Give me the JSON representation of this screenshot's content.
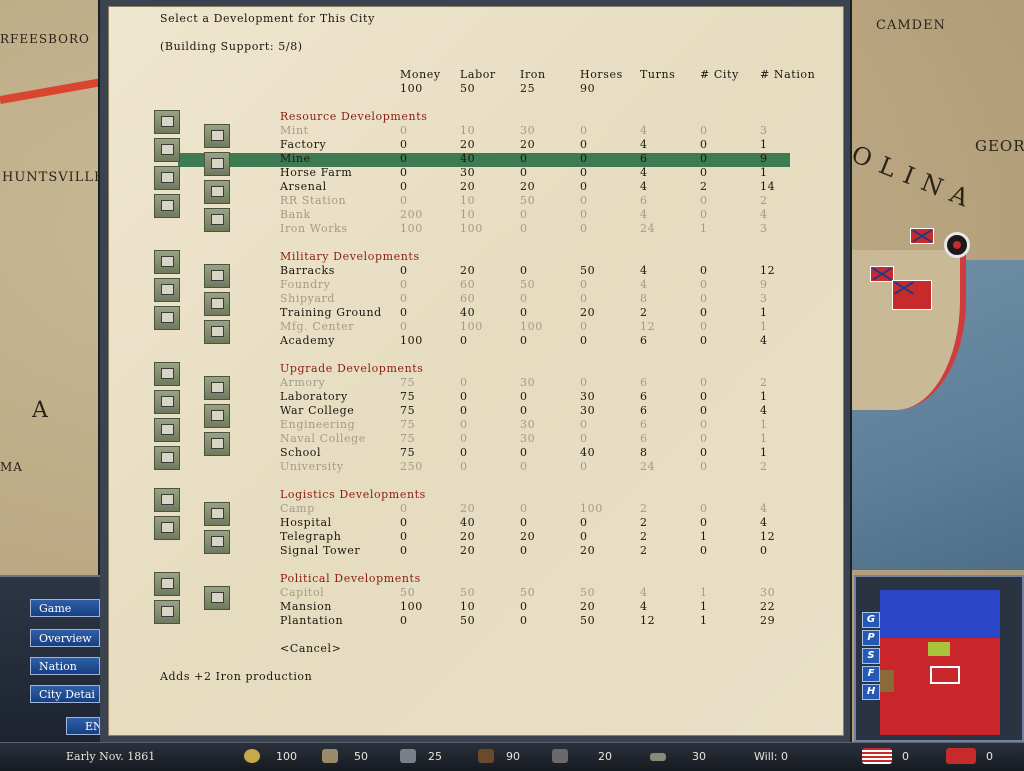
{
  "map": {
    "labels": [
      "CAMDEN",
      "RFEESBORO",
      "HUNTSVILLE",
      "GEORG",
      "OLINA",
      "MA",
      "A"
    ]
  },
  "dialog": {
    "title": "Select a Development for This City",
    "support": "(Building Support: 5/8)",
    "columns": [
      "Money",
      "Labor",
      "Iron",
      "Horses",
      "Turns",
      "# City",
      "# Nation"
    ],
    "available": [
      "100",
      "50",
      "25",
      "90"
    ],
    "cancel": "<Cancel>",
    "description": "Adds +2 Iron production",
    "sections": [
      {
        "name": "Resource Developments",
        "rows": [
          {
            "name": "Mint",
            "vals": [
              "0",
              "10",
              "30",
              "0",
              "4",
              "0",
              "3"
            ],
            "enabled": false
          },
          {
            "name": "Factory",
            "vals": [
              "0",
              "20",
              "20",
              "0",
              "4",
              "0",
              "1"
            ],
            "enabled": true
          },
          {
            "name": "Mine",
            "vals": [
              "0",
              "40",
              "0",
              "0",
              "6",
              "0",
              "9"
            ],
            "enabled": true,
            "selected": true
          },
          {
            "name": "Horse Farm",
            "vals": [
              "0",
              "30",
              "0",
              "0",
              "4",
              "0",
              "1"
            ],
            "enabled": true
          },
          {
            "name": "Arsenal",
            "vals": [
              "0",
              "20",
              "20",
              "0",
              "4",
              "2",
              "14"
            ],
            "enabled": true
          },
          {
            "name": "RR Station",
            "vals": [
              "0",
              "10",
              "50",
              "0",
              "6",
              "0",
              "2"
            ],
            "enabled": false
          },
          {
            "name": "Bank",
            "vals": [
              "200",
              "10",
              "0",
              "0",
              "4",
              "0",
              "4"
            ],
            "enabled": false
          },
          {
            "name": "Iron Works",
            "vals": [
              "100",
              "100",
              "0",
              "0",
              "24",
              "1",
              "3"
            ],
            "enabled": false
          }
        ]
      },
      {
        "name": "Military Developments",
        "rows": [
          {
            "name": "Barracks",
            "vals": [
              "0",
              "20",
              "0",
              "50",
              "4",
              "0",
              "12"
            ],
            "enabled": true
          },
          {
            "name": "Foundry",
            "vals": [
              "0",
              "60",
              "50",
              "0",
              "4",
              "0",
              "9"
            ],
            "enabled": false
          },
          {
            "name": "Shipyard",
            "vals": [
              "0",
              "60",
              "0",
              "0",
              "8",
              "0",
              "3"
            ],
            "enabled": false
          },
          {
            "name": "Training Ground",
            "vals": [
              "0",
              "40",
              "0",
              "20",
              "2",
              "0",
              "1"
            ],
            "enabled": true
          },
          {
            "name": "Mfg. Center",
            "vals": [
              "0",
              "100",
              "100",
              "0",
              "12",
              "0",
              "1"
            ],
            "enabled": false
          },
          {
            "name": "Academy",
            "vals": [
              "100",
              "0",
              "0",
              "0",
              "6",
              "0",
              "4"
            ],
            "enabled": true
          }
        ]
      },
      {
        "name": "Upgrade Developments",
        "rows": [
          {
            "name": "Armory",
            "vals": [
              "75",
              "0",
              "30",
              "0",
              "6",
              "0",
              "2"
            ],
            "enabled": false
          },
          {
            "name": "Laboratory",
            "vals": [
              "75",
              "0",
              "0",
              "30",
              "6",
              "0",
              "1"
            ],
            "enabled": true
          },
          {
            "name": "War College",
            "vals": [
              "75",
              "0",
              "0",
              "30",
              "6",
              "0",
              "4"
            ],
            "enabled": true
          },
          {
            "name": "Engineering",
            "vals": [
              "75",
              "0",
              "30",
              "0",
              "6",
              "0",
              "1"
            ],
            "enabled": false
          },
          {
            "name": "Naval College",
            "vals": [
              "75",
              "0",
              "30",
              "0",
              "6",
              "0",
              "1"
            ],
            "enabled": false
          },
          {
            "name": "School",
            "vals": [
              "75",
              "0",
              "0",
              "40",
              "8",
              "0",
              "1"
            ],
            "enabled": true
          },
          {
            "name": "University",
            "vals": [
              "250",
              "0",
              "0",
              "0",
              "24",
              "0",
              "2"
            ],
            "enabled": false
          }
        ]
      },
      {
        "name": "Logistics Developments",
        "rows": [
          {
            "name": "Camp",
            "vals": [
              "0",
              "20",
              "0",
              "100",
              "2",
              "0",
              "4"
            ],
            "enabled": false
          },
          {
            "name": "Hospital",
            "vals": [
              "0",
              "40",
              "0",
              "0",
              "2",
              "0",
              "4"
            ],
            "enabled": true
          },
          {
            "name": "Telegraph",
            "vals": [
              "0",
              "20",
              "20",
              "0",
              "2",
              "1",
              "12"
            ],
            "enabled": true
          },
          {
            "name": "Signal Tower",
            "vals": [
              "0",
              "20",
              "0",
              "20",
              "2",
              "0",
              "0"
            ],
            "enabled": true
          }
        ]
      },
      {
        "name": "Political Developments",
        "rows": [
          {
            "name": "Capitol",
            "vals": [
              "50",
              "50",
              "50",
              "50",
              "4",
              "1",
              "30"
            ],
            "enabled": false
          },
          {
            "name": "Mansion",
            "vals": [
              "100",
              "10",
              "0",
              "20",
              "4",
              "1",
              "22"
            ],
            "enabled": true
          },
          {
            "name": "Plantation",
            "vals": [
              "0",
              "50",
              "0",
              "50",
              "12",
              "1",
              "29"
            ],
            "enabled": true
          }
        ]
      }
    ]
  },
  "nav": {
    "game": "Game",
    "overview": "Overview",
    "nation": "Nation",
    "city_detail": "City Detai",
    "end": "EN"
  },
  "minimap": {
    "buttons": [
      "G",
      "P",
      "S",
      "F",
      "H"
    ]
  },
  "status": {
    "date": "Early Nov. 1861",
    "money": "100",
    "labor": "50",
    "iron": "25",
    "horses": "90",
    "guns": "20",
    "rail": "30",
    "will": "Will: 0",
    "us_score": "0",
    "cs_score": "0"
  },
  "colors": {
    "header": "#8c1d12",
    "selected_row": "#3e7a52",
    "disabled_text": "#a49b86",
    "nav_button": "#2f5fa8"
  }
}
